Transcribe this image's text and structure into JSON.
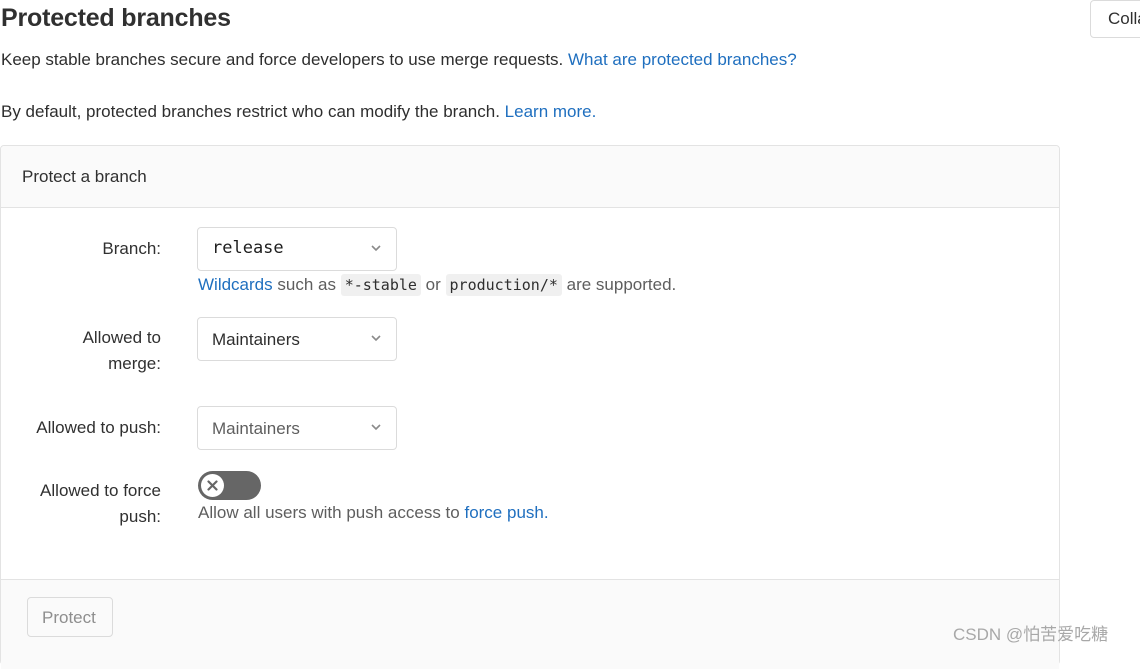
{
  "header": {
    "title": "Protected branches",
    "collapse_label": "Collapse"
  },
  "intro": {
    "line1_text": "Keep stable branches secure and force developers to use merge requests.",
    "line1_link": "What are protected branches?",
    "line2_text": "By default, protected branches restrict who can modify the branch.",
    "line2_link": "Learn more."
  },
  "form": {
    "panel_title": "Protect a branch",
    "branch": {
      "label": "Branch:",
      "value": "release",
      "help_link": "Wildcards",
      "help_text1": "such as",
      "code1": "*-stable",
      "help_text2": "or",
      "code2": "production/*",
      "help_text3": "are supported."
    },
    "merge": {
      "label_line1": "Allowed to",
      "label_line2": "merge:",
      "value": "Maintainers"
    },
    "push": {
      "label": "Allowed to push:",
      "value": "Maintainers"
    },
    "force_push": {
      "label_line1": "Allowed to force",
      "label_line2": "push:",
      "enabled": false,
      "help_text": "Allow all users with push access to",
      "help_link": "force push."
    },
    "submit_label": "Protect"
  },
  "watermark": "CSDN @怕苦爱吃糖",
  "colors": {
    "link": "#1f6fbf",
    "toggle_off": "#666666"
  },
  "icons": [
    "chevron-down-icon",
    "close-icon"
  ]
}
